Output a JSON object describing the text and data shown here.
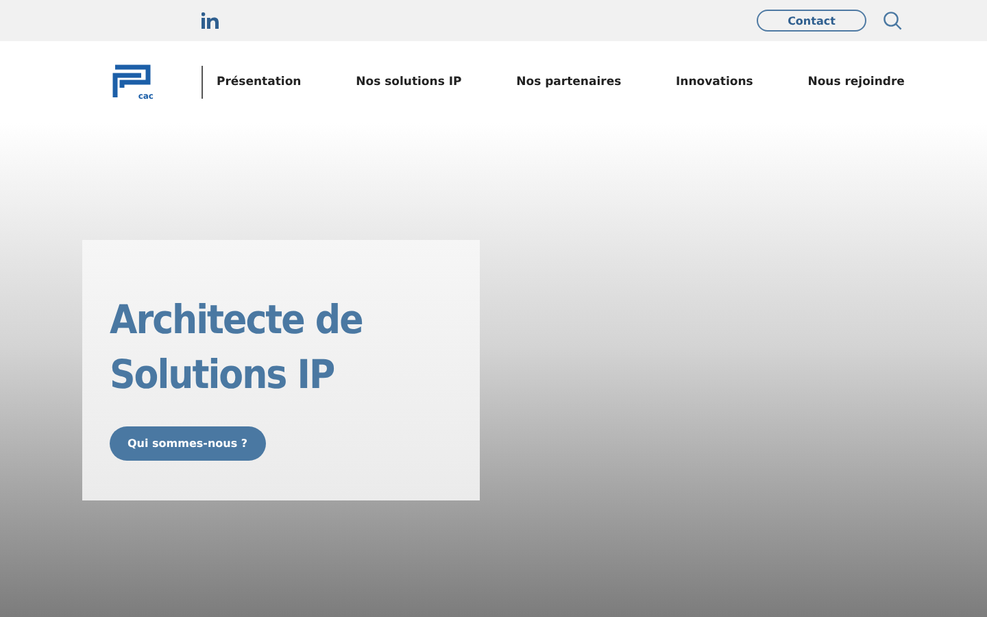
{
  "top_bar": {
    "contact_button": "Contact"
  },
  "logo": {
    "text": "cac"
  },
  "nav": {
    "items": [
      {
        "label": "Présentation"
      },
      {
        "label": "Nos solutions IP"
      },
      {
        "label": "Nos partenaires"
      },
      {
        "label": "Innovations"
      },
      {
        "label": "Nous rejoindre"
      }
    ]
  },
  "hero": {
    "title": "Architecte de Solutions IP",
    "button": "Qui sommes-nous ?"
  }
}
